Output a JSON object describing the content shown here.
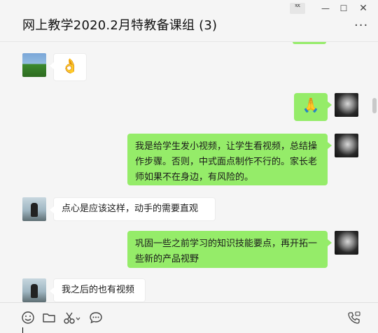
{
  "window": {
    "title": "网上教学2020.2月特教备课组 (3)",
    "pin_label": "ᅑ",
    "min_glyph": "—",
    "max_glyph": "☐",
    "close_glyph": "✕",
    "more_glyph": "···"
  },
  "messages": [
    {
      "side": "in",
      "avatar": "landscape-avatar",
      "text": "👌"
    },
    {
      "side": "out",
      "avatar": "monochrome-avatar",
      "text": "🙏"
    },
    {
      "side": "out",
      "avatar": "monochrome-avatar",
      "text": "我是给学生发小视频，让学生看视频，总结操作步骤。否则，中式面点制作不行的。家长老师如果不在身边，有风险的。"
    },
    {
      "side": "in",
      "avatar": "rider-avatar",
      "text": "点心是应该这样，动手的需要直观"
    },
    {
      "side": "out",
      "avatar": "monochrome-avatar",
      "text": "巩固一些之前学习的知识技能要点，再开拓一些新的产品视野"
    },
    {
      "side": "in",
      "avatar": "rider-avatar",
      "text": "我之后的也有视频"
    }
  ],
  "toolbar": {
    "icons": [
      "emoji-icon",
      "folder-icon",
      "scissors-icon",
      "chat-bubble-icon",
      "video-call-icon"
    ]
  },
  "colors": {
    "outgoing_bubble": "#95ec69",
    "incoming_bubble": "#ffffff",
    "background": "#f5f5f5"
  }
}
